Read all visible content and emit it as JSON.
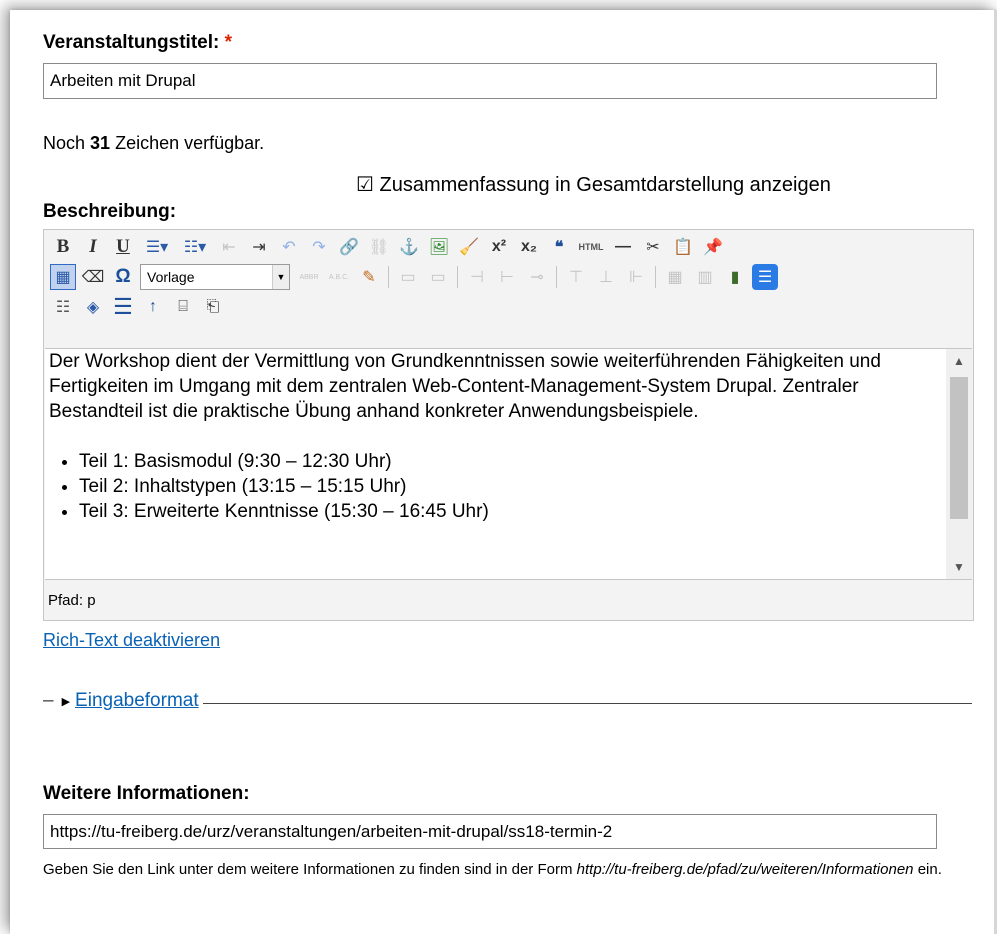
{
  "title_field": {
    "label": "Veranstaltungstitel:",
    "required_mark": "*",
    "value": "Arbeiten mit Drupal"
  },
  "char_counter": {
    "prefix": "Noch",
    "count": "31",
    "suffix": "Zeichen verfügbar."
  },
  "summary_checkbox": {
    "checked_glyph": "☑",
    "label": "Zusammenfassung in Gesamtdarstellung anzeigen"
  },
  "description": {
    "label": "Beschreibung:",
    "format_select_value": "Vorlage",
    "paragraph": "Der Workshop dient der Vermittlung von Grundkenntnissen sowie weiterführenden Fähigkeiten und Fertigkeiten im Umgang mit dem zentralen Web-Content-Management-System Drupal. Zentraler Bestandteil ist die praktische Übung anhand konkreter Anwendungsbeispiele.",
    "list": [
      "Teil 1: Basismodul (9:30 – 12:30 Uhr)",
      "Teil 2: Inhaltstypen (13:15 – 15:15 Uhr)",
      "Teil 3: Erweiterte Kenntnisse (15:30 – 16:45 Uhr)"
    ],
    "path": "Pfad: p",
    "toolbar_row1": [
      "B",
      "I",
      "U",
      "☰▾",
      "☷▾",
      "⇤",
      "⇥",
      "↶",
      "↷",
      "🔗",
      "⛓",
      "⚓",
      "🖼",
      "🧹",
      "x²",
      "x₂",
      "❝",
      "HTML",
      "—",
      "✂",
      "📋",
      "📌"
    ],
    "toolbar_row2": [
      "▦",
      "⌫",
      "Ω"
    ],
    "toolbar_row2b": [
      "ABBR",
      "A.B.C.",
      "✎",
      "▭",
      "▭",
      "⊣",
      "⊢",
      "⊸",
      "⊤",
      "⊥",
      "⊩",
      "▦",
      "▥",
      "▮",
      "☰"
    ],
    "toolbar_row3": [
      "☷",
      "◈",
      "☰",
      "↑",
      "⌸",
      "⎗"
    ]
  },
  "rich_text_toggle": "Rich-Text deaktivieren",
  "input_format_legend": "Eingabeformat",
  "more_info": {
    "label": "Weitere Informationen:",
    "value": "https://tu-freiberg.de/urz/veranstaltungen/arbeiten-mit-drupal/ss18-termin-2",
    "help_prefix": "Geben Sie den Link unter dem weitere Informationen zu finden sind in der Form",
    "help_example": "http://tu-freiberg.de/pfad/zu/weiteren/Informationen",
    "help_suffix": "ein."
  },
  "colors": {
    "link": "#0a62b5",
    "required": "#dd2200",
    "selected_button": "#c1d2ee"
  }
}
